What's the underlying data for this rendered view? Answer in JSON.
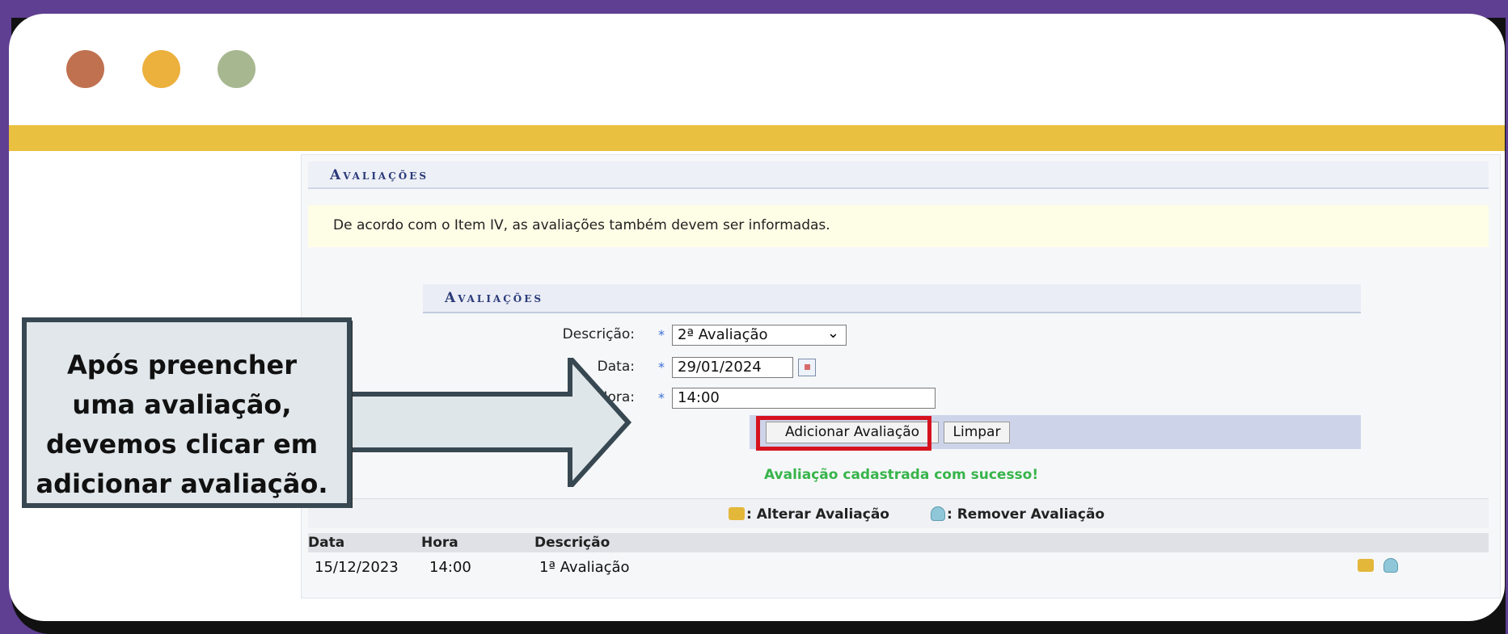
{
  "panel": {
    "section_title": "Avaliações",
    "info_message": "De acordo com o Item IV, as avaliações também devem ser informadas.",
    "sub_title": "Avaliações"
  },
  "form": {
    "descricao_label": "Descrição:",
    "descricao_value": "2ª Avaliação",
    "data_label": "Data:",
    "data_value": "29/01/2024",
    "hora_label": "Hora:",
    "hora_value": "14:00",
    "required_mark": "*"
  },
  "buttons": {
    "add": "Adicionar Avaliação",
    "clear": "Limpar"
  },
  "success_message": "Avaliação cadastrada com sucesso!",
  "legend": {
    "edit": ": Alterar Avaliação",
    "remove": ": Remover Avaliação"
  },
  "table": {
    "headers": [
      "Data",
      "Hora",
      "Descrição"
    ],
    "rows": [
      {
        "data": "15/12/2023",
        "hora": "14:00",
        "descricao": "1ª Avaliação"
      }
    ]
  },
  "callout": {
    "text": "Após preencher uma avaliação, devemos clicar em adicionar avaliação."
  },
  "colors": {
    "background": "#5f3f91",
    "stripe": "#e9c03f",
    "highlight": "#d6121f",
    "success": "#37b44a",
    "dot_red": "#c07150",
    "dot_yellow": "#ecb03c",
    "dot_green": "#a7b890"
  },
  "icons": [
    "edit-icon",
    "trash-icon",
    "calendar-icon",
    "chevron-down-icon"
  ]
}
